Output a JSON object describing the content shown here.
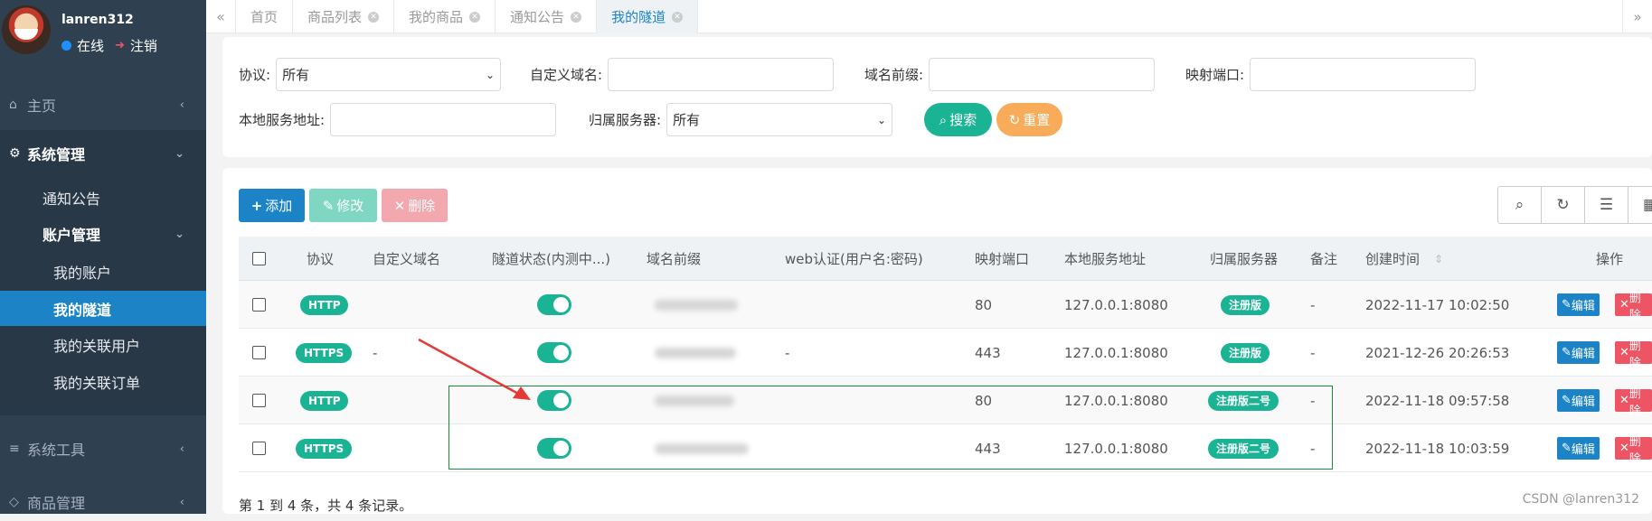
{
  "user": {
    "name": "lanren312",
    "status": "在线",
    "logout": "注销"
  },
  "sidebar": {
    "home": "主页",
    "system": "系统管理",
    "notice": "通知公告",
    "account": "账户管理",
    "my_account": "我的账户",
    "my_tunnel": "我的隧道",
    "my_users": "我的关联用户",
    "my_orders": "我的关联订单",
    "tools": "系统工具",
    "goods": "商品管理"
  },
  "tabs": [
    {
      "label": "首页"
    },
    {
      "label": "商品列表"
    },
    {
      "label": "我的商品"
    },
    {
      "label": "通知公告"
    },
    {
      "label": "我的隧道"
    }
  ],
  "search": {
    "protocol_label": "协议:",
    "protocol_value": "所有",
    "domain_label": "自定义域名:",
    "prefix_label": "域名前缀:",
    "port_label": "映射端口:",
    "local_label": "本地服务地址:",
    "server_label": "归属服务器:",
    "server_value": "所有",
    "search_btn": "搜索",
    "reset_btn": "重置"
  },
  "toolbar": {
    "add": "添加",
    "edit": "修改",
    "delete": "删除"
  },
  "table": {
    "headers": {
      "protocol": "协议",
      "domain": "自定义域名",
      "status": "隧道状态(内测中...)",
      "prefix": "域名前缀",
      "webauth": "web认证(用户名:密码)",
      "port": "映射端口",
      "local": "本地服务地址",
      "server": "归属服务器",
      "note": "备注",
      "created": "创建时间",
      "ops": "操作"
    },
    "rows": [
      {
        "protocol": "HTTP",
        "domain": "",
        "webauth": "",
        "port": "80",
        "local": "127.0.0.1:8080",
        "server": "注册版",
        "note": "-",
        "created": "2022-11-17 10:02:50"
      },
      {
        "protocol": "HTTPS",
        "domain": "-",
        "webauth": "-",
        "port": "443",
        "local": "127.0.0.1:8080",
        "server": "注册版",
        "note": "-",
        "created": "2021-12-26 20:26:53"
      },
      {
        "protocol": "HTTP",
        "domain": "",
        "webauth": "",
        "port": "80",
        "local": "127.0.0.1:8080",
        "server": "注册版二号",
        "note": "-",
        "created": "2022-11-18 09:57:58"
      },
      {
        "protocol": "HTTPS",
        "domain": "",
        "webauth": "",
        "port": "443",
        "local": "127.0.0.1:8080",
        "server": "注册版二号",
        "note": "-",
        "created": "2022-11-18 10:03:59"
      }
    ],
    "edit_label": "编辑",
    "delete_label": "删除"
  },
  "footer": "第 1 到 4 条，共 4 条记录。",
  "watermark": "CSDN @lanren312",
  "colors": {
    "sidebar": "#2f4050",
    "primary": "#1c84c6",
    "success": "#1ab394",
    "warning": "#f8ac59",
    "danger": "#ed5565"
  }
}
